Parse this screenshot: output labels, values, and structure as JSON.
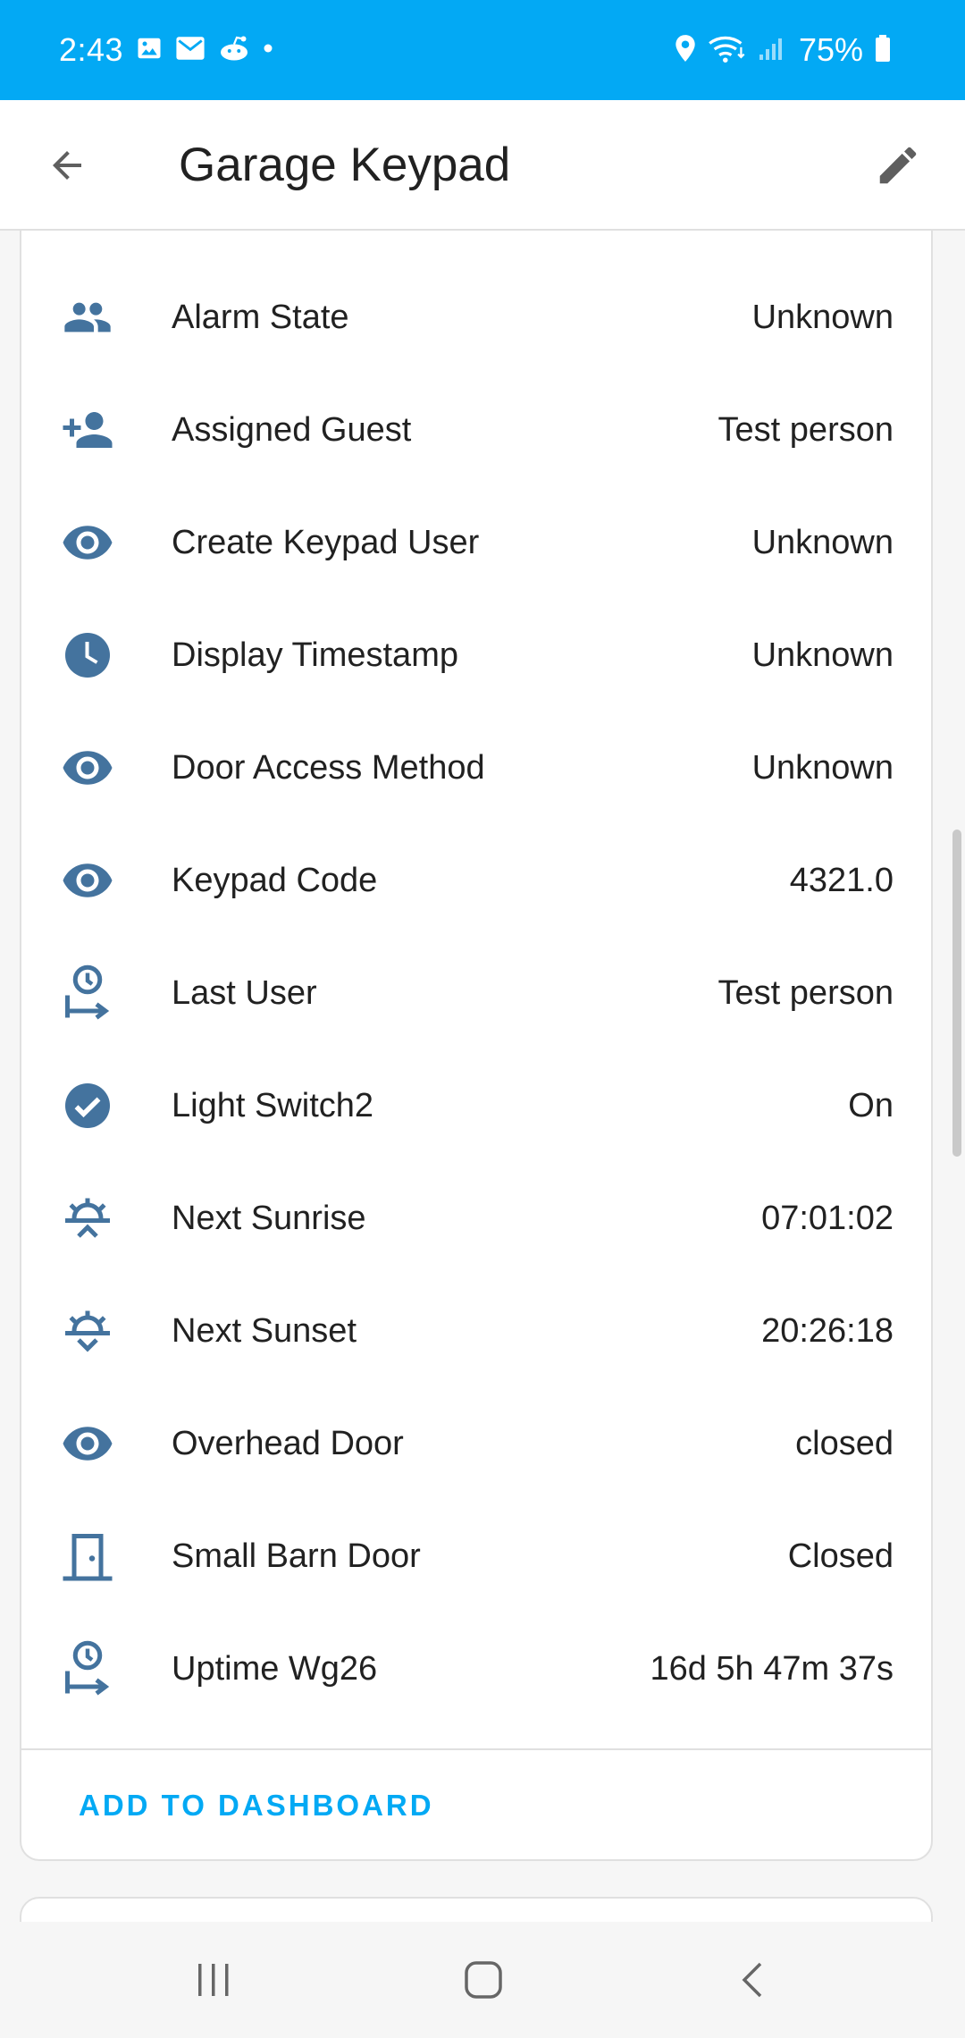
{
  "status_bar": {
    "time": "2:43",
    "battery": "75%"
  },
  "app_bar": {
    "title": "Garage Keypad"
  },
  "entities": [
    {
      "name": "Alarm State",
      "value": "Unknown",
      "icon": "account-group-icon"
    },
    {
      "name": "Assigned Guest",
      "value": "Test person",
      "icon": "account-plus-icon"
    },
    {
      "name": "Create Keypad User",
      "value": "Unknown",
      "icon": "eye-icon"
    },
    {
      "name": "Display Timestamp",
      "value": "Unknown",
      "icon": "clock-icon"
    },
    {
      "name": "Door Access Method",
      "value": "Unknown",
      "icon": "eye-icon"
    },
    {
      "name": "Keypad Code",
      "value": "4321.0",
      "icon": "eye-icon"
    },
    {
      "name": "Last User",
      "value": "Test person",
      "icon": "timer-user-icon"
    },
    {
      "name": "Light Switch2",
      "value": "On",
      "icon": "check-circle-icon"
    },
    {
      "name": "Next Sunrise",
      "value": "07:01:02",
      "icon": "sunrise-icon"
    },
    {
      "name": "Next Sunset",
      "value": "20:26:18",
      "icon": "sunset-icon"
    },
    {
      "name": "Overhead Door",
      "value": "closed",
      "icon": "eye-icon"
    },
    {
      "name": "Small Barn Door",
      "value": "Closed",
      "icon": "door-icon"
    },
    {
      "name": "Uptime Wg26",
      "value": "16d 5h 47m 37s",
      "icon": "timer-user-icon"
    }
  ],
  "card": {
    "add_button_label": "ADD TO DASHBOARD"
  },
  "colors": {
    "accent": "#03a9f4",
    "icon": "#44739e",
    "text": "#212121"
  }
}
